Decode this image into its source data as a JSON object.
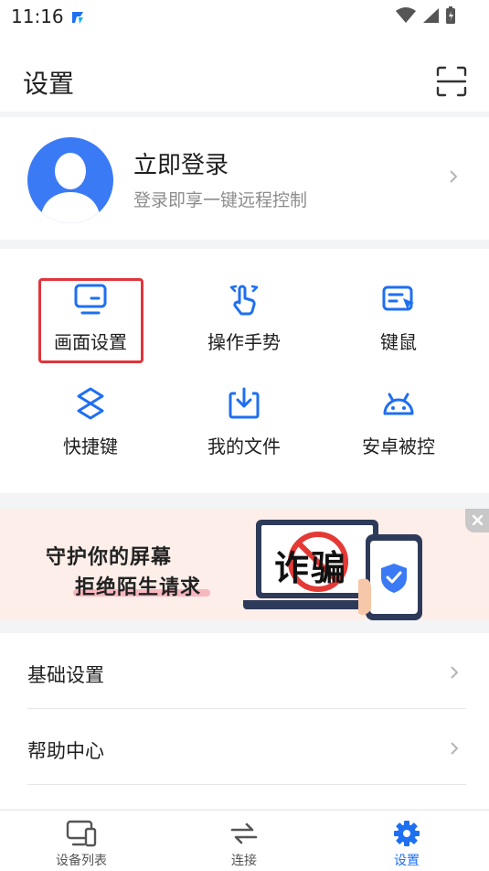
{
  "status_bar": {
    "time": "11:16"
  },
  "header": {
    "title": "设置"
  },
  "login": {
    "title": "立即登录",
    "subtitle": "登录即享一键远程控制"
  },
  "quick_settings": [
    {
      "label": "画面设置",
      "icon": "monitor-icon",
      "highlighted": true
    },
    {
      "label": "操作手势",
      "icon": "gesture-icon"
    },
    {
      "label": "键鼠",
      "icon": "keyboard-mouse-icon"
    },
    {
      "label": "快捷键",
      "icon": "shortcut-icon"
    },
    {
      "label": "我的文件",
      "icon": "download-file-icon"
    },
    {
      "label": "安卓被控",
      "icon": "android-icon"
    }
  ],
  "banner": {
    "line1": "守护你的屏幕",
    "line2": "拒绝陌生请求",
    "scam_text": "诈骗"
  },
  "list": [
    {
      "label": "基础设置"
    },
    {
      "label": "帮助中心"
    }
  ],
  "tabbar": [
    {
      "label": "设备列表",
      "icon": "devices-icon",
      "active": false
    },
    {
      "label": "连接",
      "icon": "connect-arrows-icon",
      "active": false
    },
    {
      "label": "设置",
      "icon": "gear-icon",
      "active": true
    }
  ],
  "colors": {
    "accent": "#1e6ff1",
    "highlight_border": "#e0353b",
    "avatar_bg": "#3b7af5",
    "banner_bg": "#fdeee9"
  }
}
